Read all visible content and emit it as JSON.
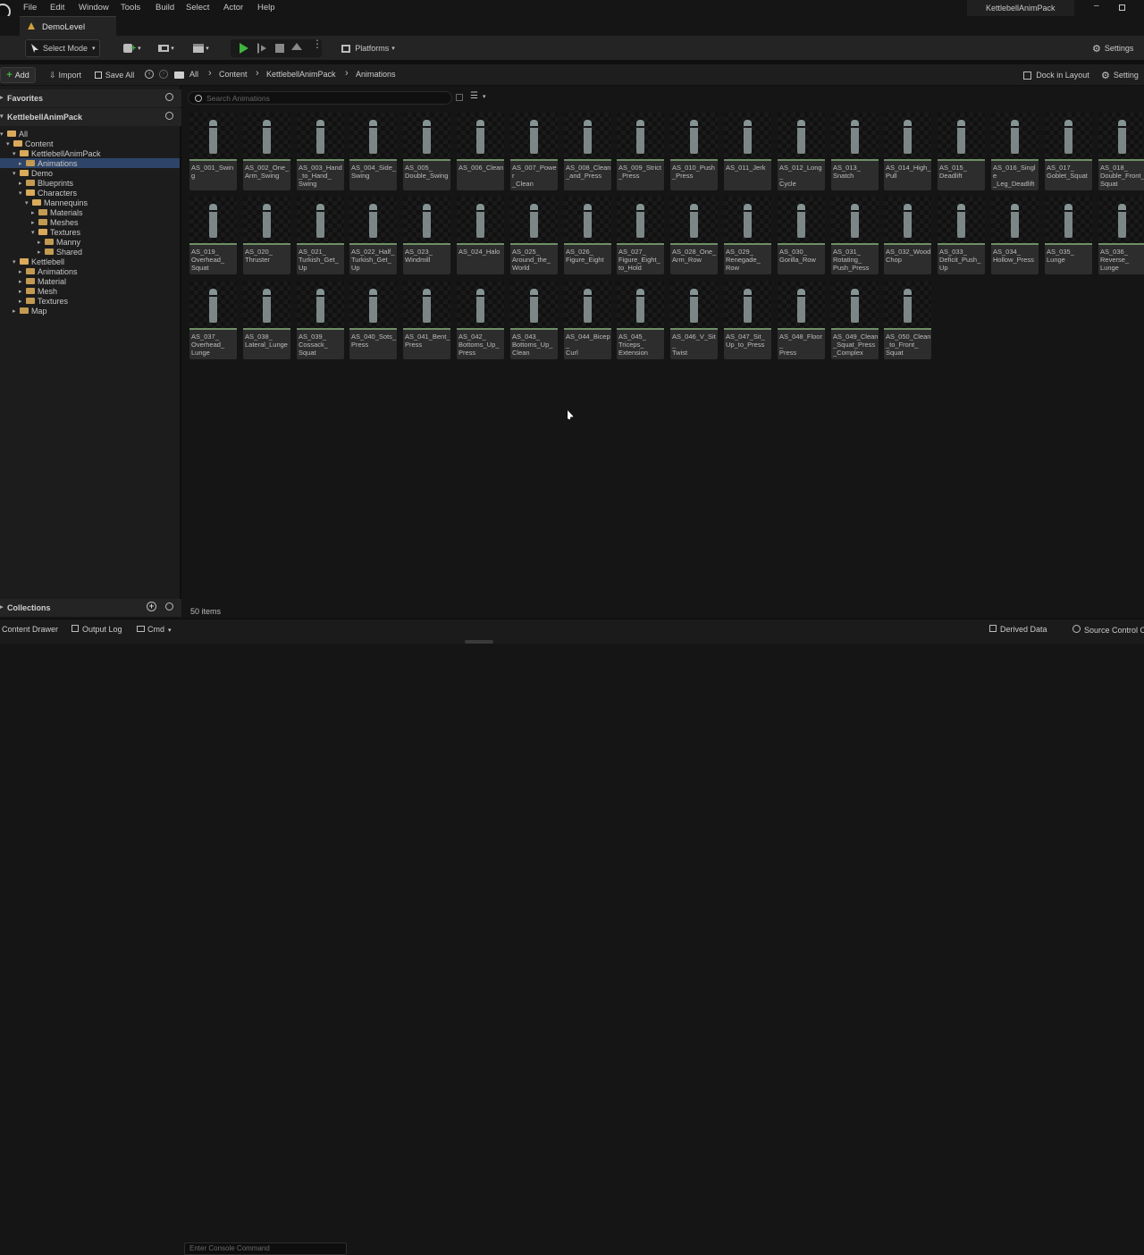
{
  "menu": [
    "File",
    "Edit",
    "Window",
    "Tools",
    "Build",
    "Select",
    "Actor",
    "Help"
  ],
  "project_name": "KettlebellAnimPack",
  "level_tab": "DemoLevel",
  "toolbar": {
    "select_mode": "Select Mode",
    "platforms": "Platforms",
    "settings": "Settings"
  },
  "cb": {
    "add": "Add",
    "import": "Import",
    "save_all": "Save All",
    "crumbs": [
      "All",
      "Content",
      "KettlebellAnimPack",
      "Animations"
    ],
    "dock": "Dock in Layout",
    "settings": "Setting"
  },
  "sidebar": {
    "favorites": "Favorites",
    "root": "KettlebellAnimPack",
    "collections": "Collections",
    "tree": [
      {
        "label": "All",
        "depth": 0,
        "open": true
      },
      {
        "label": "Content",
        "depth": 1,
        "open": true
      },
      {
        "label": "KettlebellAnimPack",
        "depth": 2,
        "open": true
      },
      {
        "label": "Animations",
        "depth": 3,
        "open": false,
        "selected": true
      },
      {
        "label": "Demo",
        "depth": 2,
        "open": true
      },
      {
        "label": "Blueprints",
        "depth": 3,
        "open": false
      },
      {
        "label": "Characters",
        "depth": 3,
        "open": true
      },
      {
        "label": "Mannequins",
        "depth": 4,
        "open": true
      },
      {
        "label": "Materials",
        "depth": 5,
        "open": false
      },
      {
        "label": "Meshes",
        "depth": 5,
        "open": false
      },
      {
        "label": "Textures",
        "depth": 5,
        "open": true
      },
      {
        "label": "Manny",
        "depth": 6,
        "open": false
      },
      {
        "label": "Shared",
        "depth": 6,
        "open": false
      },
      {
        "label": "Kettlebell",
        "depth": 2,
        "open": true
      },
      {
        "label": "Animations",
        "depth": 3,
        "open": false
      },
      {
        "label": "Material",
        "depth": 3,
        "open": false
      },
      {
        "label": "Mesh",
        "depth": 3,
        "open": false
      },
      {
        "label": "Textures",
        "depth": 3,
        "open": false
      },
      {
        "label": "Map",
        "depth": 2,
        "open": false
      }
    ]
  },
  "search_placeholder": "Search Animations",
  "items_count": "50 items",
  "assets": [
    [
      "AS_001_Swing"
    ],
    [
      "AS_002_One_",
      "Arm_Swing"
    ],
    [
      "AS_003_Hand",
      "_to_Hand_",
      "Swing"
    ],
    [
      "AS_004_Side_",
      "Swing"
    ],
    [
      "AS_005_",
      "Double_Swing"
    ],
    [
      "AS_006_Clean"
    ],
    [
      "AS_007_Power",
      "_Clean"
    ],
    [
      "AS_008_Clean",
      "_and_Press"
    ],
    [
      "AS_009_Strict",
      "_Press"
    ],
    [
      "AS_010_Push",
      "_Press"
    ],
    [
      "AS_011_Jerk"
    ],
    [
      "AS_012_Long_",
      "Cycle"
    ],
    [
      "AS_013_",
      "Snatch"
    ],
    [
      "AS_014_High_",
      "Pull"
    ],
    [
      "AS_015_",
      "Deadlift"
    ],
    [
      "AS_016_Single",
      "_Leg_Deadlift"
    ],
    [
      "AS_017_",
      "Goblet_Squat"
    ],
    [
      "AS_018_",
      "Double_Front_",
      "Squat"
    ],
    [
      "AS_019_",
      "Overhead_",
      "Squat"
    ],
    [
      "AS_020_",
      "Thruster"
    ],
    [
      "AS_021_",
      "Turkish_Get_",
      "Up"
    ],
    [
      "AS_022_Half_",
      "Turkish_Get_",
      "Up"
    ],
    [
      "AS_023_",
      "Windmill"
    ],
    [
      "AS_024_Halo"
    ],
    [
      "AS_025_",
      "Around_the_",
      "World"
    ],
    [
      "AS_026_",
      "Figure_Eight"
    ],
    [
      "AS_027_",
      "Figure_Eight_",
      "to_Hold"
    ],
    [
      "AS_028_One_",
      "Arm_Row"
    ],
    [
      "AS_029_",
      "Renegade_",
      "Row"
    ],
    [
      "AS_030_",
      "Gorilla_Row"
    ],
    [
      "AS_031_",
      "Rotating_",
      "Push_Press"
    ],
    [
      "AS_032_Wood",
      "Chop"
    ],
    [
      "AS_033_",
      "Deficit_Push_",
      "Up"
    ],
    [
      "AS_034_",
      "Hollow_Press"
    ],
    [
      "AS_035_",
      "Lunge"
    ],
    [
      "AS_036_",
      "Reverse_",
      "Lunge"
    ],
    [
      "AS_037_",
      "Overhead_",
      "Lunge"
    ],
    [
      "AS_038_",
      "Lateral_Lunge"
    ],
    [
      "AS_039_",
      "Cossack_",
      "Squat"
    ],
    [
      "AS_040_Sots_",
      "Press"
    ],
    [
      "AS_041_Bent_",
      "Press"
    ],
    [
      "AS_042_",
      "Bottoms_Up_",
      "Press"
    ],
    [
      "AS_043_",
      "Bottoms_Up_",
      "Clean"
    ],
    [
      "AS_044_Bicep_",
      "Curl"
    ],
    [
      "AS_045_",
      "Triceps_",
      "Extension"
    ],
    [
      "AS_046_V_Sit_",
      "Twist"
    ],
    [
      "AS_047_Sit_",
      "Up_to_Press"
    ],
    [
      "AS_048_Floor_",
      "Press"
    ],
    [
      "AS_049_Clean",
      "_Squat_Press",
      "_Complex"
    ],
    [
      "AS_050_Clean",
      "_to_Front_",
      "Squat"
    ]
  ],
  "status": {
    "content_drawer": "Content Drawer",
    "output_log": "Output Log",
    "cmd": "Cmd",
    "console_placeholder": "Enter Console Command",
    "derived": "Derived Data",
    "source": "Source Control O"
  },
  "colors": {
    "folder": "#c39a52",
    "play": "#3fb43f",
    "selected": "#2e4468",
    "asset_bar": "#6f8f67"
  }
}
